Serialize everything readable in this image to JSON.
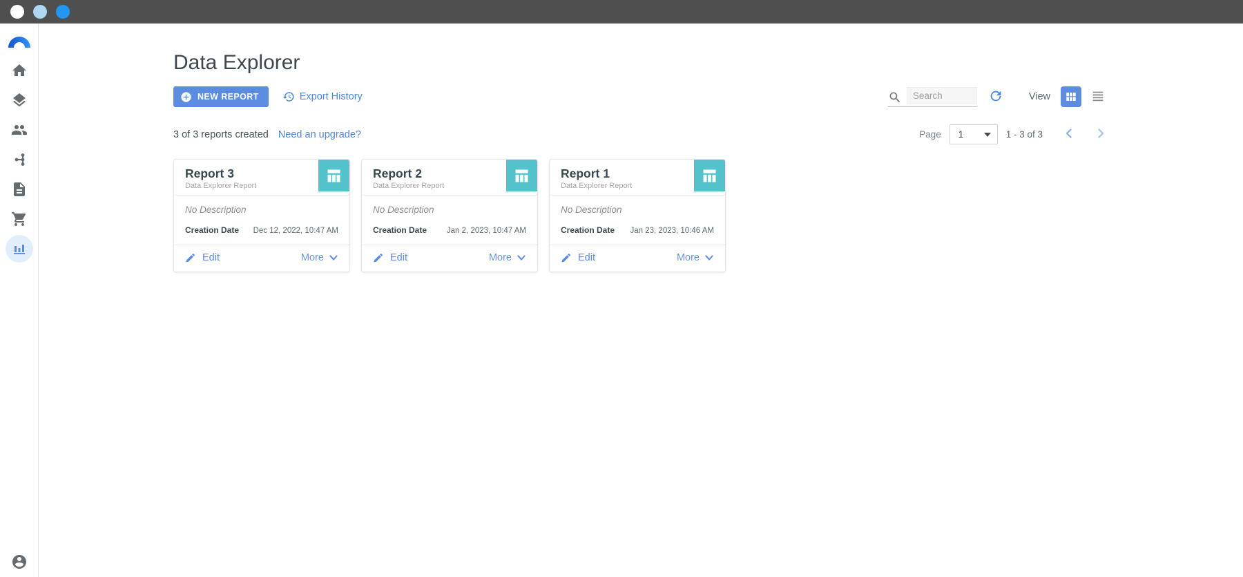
{
  "titlebar": {
    "button_colors": [
      "#ffffff",
      "#aed6f1",
      "#2196f3"
    ]
  },
  "sidebar": {
    "icons": [
      "logo",
      "home",
      "layers",
      "people",
      "pipeline",
      "document",
      "cart",
      "bar-chart",
      "account"
    ],
    "active_icon": "bar-chart"
  },
  "header": {
    "title": "Data Explorer"
  },
  "toolbar": {
    "new_report": "NEW REPORT",
    "export_history": "Export History",
    "search_placeholder": "Search",
    "view_label": "View"
  },
  "status": {
    "reports_created": "3 of 3 reports created",
    "upgrade_link": "Need an upgrade?"
  },
  "pagination": {
    "page_label": "Page",
    "page_value": "1",
    "range_text": "1 - 3 of 3"
  },
  "cards": [
    {
      "title": "Report 3",
      "subtitle": "Data Explorer Report",
      "description": "No Description",
      "creation_date_label": "Creation Date",
      "creation_date": "Dec 12, 2022, 10:47 AM",
      "edit_label": "Edit",
      "more_label": "More"
    },
    {
      "title": "Report 2",
      "subtitle": "Data Explorer Report",
      "description": "No Description",
      "creation_date_label": "Creation Date",
      "creation_date": "Jan 2, 2023, 10:47 AM",
      "edit_label": "Edit",
      "more_label": "More"
    },
    {
      "title": "Report 1",
      "subtitle": "Data Explorer Report",
      "description": "No Description",
      "creation_date_label": "Creation Date",
      "creation_date": "Jan 23, 2023, 10:46 AM",
      "edit_label": "Edit",
      "more_label": "More"
    }
  ],
  "colors": {
    "titlebar_bg": "#4f4f4f",
    "accent_blue": "#5b8ce0",
    "link_blue": "#4d86db",
    "card_icon_teal": "#54c2cb",
    "active_nav_bg": "#e3eefc"
  }
}
